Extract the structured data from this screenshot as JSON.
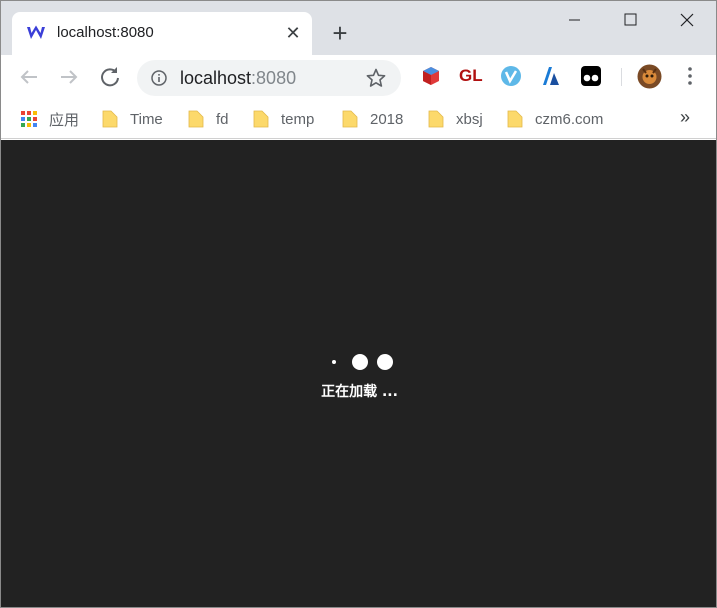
{
  "browser": {
    "tab": {
      "title": "localhost:8080"
    },
    "omnibox": {
      "host": "localhost",
      "port": ":8080"
    },
    "extensions": [
      "3d-cube-icon",
      "gl-extension-icon",
      "v-extension-icon",
      "a-extension-icon",
      "tampermonkey-icon"
    ],
    "extension_gl_label": "GL",
    "bookmarks": {
      "apps_label": "应用",
      "items": [
        {
          "label": "Time"
        },
        {
          "label": "fd"
        },
        {
          "label": "temp"
        },
        {
          "label": "2018"
        },
        {
          "label": "xbsj"
        },
        {
          "label": "czm6.com"
        }
      ],
      "more_label": "»"
    }
  },
  "page": {
    "loading_text": "正在加载 ..."
  },
  "colors": {
    "content_bg": "#222222",
    "tabstrip_bg": "#dee1e6",
    "folder": "#fcd96b"
  }
}
